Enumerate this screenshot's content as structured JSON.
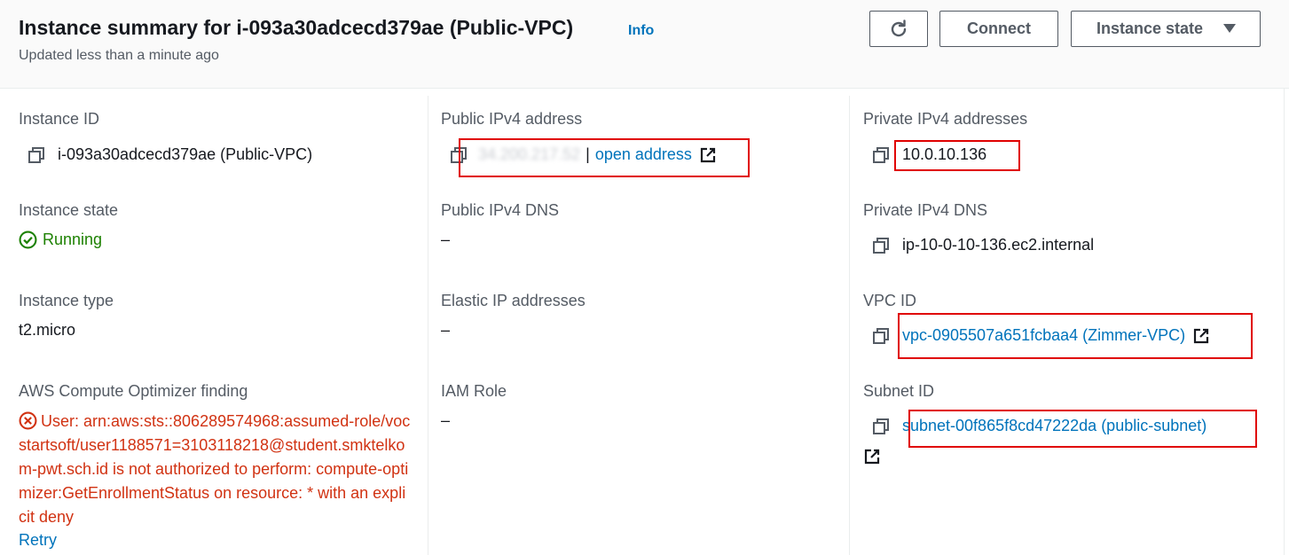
{
  "header": {
    "title": "Instance summary for i-093a30adcecd379ae (Public-VPC)",
    "info_label": "Info",
    "subtitle": "Updated less than a minute ago",
    "connect_label": "Connect",
    "instance_state_label": "Instance state"
  },
  "col1": {
    "instance_id_label": "Instance ID",
    "instance_id_value": "i-093a30adcecd379ae (Public-VPC)",
    "instance_state_label": "Instance state",
    "instance_state_value": "Running",
    "instance_type_label": "Instance type",
    "instance_type_value": "t2.micro",
    "optimizer_label": "AWS Compute Optimizer finding",
    "optimizer_error": "User: arn:aws:sts::806289574968:assumed-role/vocstartsoft/user1188571=3103118218@student.smktelkom-pwt.sch.id is not authorized to perform: compute-optimizer:GetEnrollmentStatus on resource: * with an explicit deny",
    "retry_label": "Retry"
  },
  "col2": {
    "public_ipv4_label": "Public IPv4 address",
    "public_ipv4_value": "34.200.217.52",
    "open_address_label": "open address",
    "separator": "|",
    "public_dns_label": "Public IPv4 DNS",
    "public_dns_value": "–",
    "elastic_ip_label": "Elastic IP addresses",
    "elastic_ip_value": "–",
    "iam_role_label": "IAM Role",
    "iam_role_value": "–"
  },
  "col3": {
    "private_ipv4_label": "Private IPv4 addresses",
    "private_ipv4_value": "10.0.10.136",
    "private_dns_label": "Private IPv4 DNS",
    "private_dns_value": "ip-10-0-10-136.ec2.internal",
    "vpc_id_label": "VPC ID",
    "vpc_id_value": "vpc-0905507a651fcbaa4 (Zimmer-VPC)",
    "subnet_id_label": "Subnet ID",
    "subnet_id_value": "subnet-00f865f8cd47222da (public-subnet)"
  },
  "colors": {
    "link": "#0073bb",
    "running": "#1d8102",
    "error": "#d13212",
    "annotation": "#e00000"
  },
  "icons": [
    "refresh-icon",
    "caret-down-icon",
    "copy-icon",
    "external-link-icon",
    "check-circle-icon",
    "error-circle-icon"
  ]
}
